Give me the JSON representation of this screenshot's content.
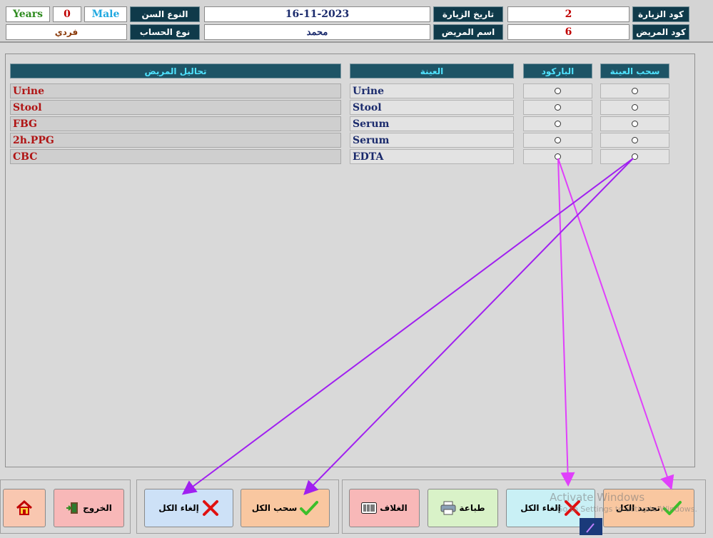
{
  "header": {
    "visit_code_label": "كود الزيارة",
    "visit_code": "2",
    "patient_code_label": "كود المريض",
    "patient_code": "6",
    "visit_date_label": "تاريخ الزيارة",
    "visit_date": "16-11-2023",
    "patient_name_label": "اسم المريض",
    "patient_name": "محمد",
    "gender_label": "النوع السن",
    "gender": "Male",
    "age": "0",
    "age_unit": "Years",
    "account_type_label": "نوع الحساب",
    "account_type": "فردي"
  },
  "table": {
    "headers": {
      "tests": "تحاليل المريض",
      "sample": "العينة",
      "barcode": "الباركود",
      "pull_sample": "سحب العينة"
    },
    "rows": [
      {
        "test": "Urine",
        "sample": "Urine"
      },
      {
        "test": "Stool",
        "sample": "Stool"
      },
      {
        "test": "FBG",
        "sample": "Serum"
      },
      {
        "test": "2h.PPG",
        "sample": "Serum"
      },
      {
        "test": "CBC",
        "sample": "EDTA"
      }
    ]
  },
  "buttons": {
    "select_all": "تحديد الكل",
    "cancel_all_barcode": "إلغاء الكل",
    "print": "طباعة",
    "envelope": "الغلاف",
    "pull_all": "سحب الكل",
    "cancel_all_pull": "إلغاء الكل",
    "exit": "الخروج"
  },
  "watermark": {
    "line1": "Activate Windows",
    "line2": "Go to Settings to activate Windows."
  },
  "colors": {
    "header_label_bg": "#0f3a4a",
    "column_header_bg": "#1e5466",
    "column_header_text": "#4fe3ff",
    "test_text": "#b01414",
    "sample_text": "#1a2a6c",
    "annotation_magenta": "#e040fb",
    "annotation_purple": "#a020f0"
  }
}
